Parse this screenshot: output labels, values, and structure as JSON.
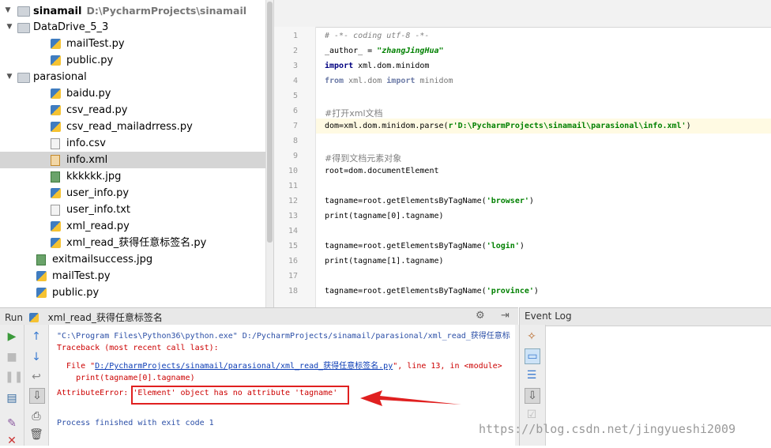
{
  "project": {
    "root": {
      "label": "sinamail",
      "path": "D:\\PycharmProjects\\sinamail"
    },
    "items": [
      {
        "label": "DataDrive_5_3",
        "kind": "folder",
        "open": true
      },
      {
        "label": "mailTest.py",
        "kind": "py"
      },
      {
        "label": "public.py",
        "kind": "py"
      },
      {
        "label": "parasional",
        "kind": "folder",
        "open": true
      },
      {
        "label": "baidu.py",
        "kind": "py"
      },
      {
        "label": "csv_read.py",
        "kind": "py"
      },
      {
        "label": "csv_read_mailadrress.py",
        "kind": "py"
      },
      {
        "label": "info.csv",
        "kind": "txt"
      },
      {
        "label": "info.xml",
        "kind": "xml",
        "selected": true
      },
      {
        "label": "kkkkkk.jpg",
        "kind": "img"
      },
      {
        "label": "user_info.py",
        "kind": "py"
      },
      {
        "label": "user_info.txt",
        "kind": "txt"
      },
      {
        "label": "xml_read.py",
        "kind": "py"
      },
      {
        "label": "xml_read_获得任意标签名.py",
        "kind": "py"
      },
      {
        "label": "exitmailsuccess.jpg",
        "kind": "img"
      },
      {
        "label": "mailTest.py",
        "kind": "py"
      },
      {
        "label": "public.py",
        "kind": "py"
      }
    ]
  },
  "editor": {
    "line_numbers": [
      "1",
      "2",
      "3",
      "4",
      "5",
      "6",
      "7",
      "8",
      "9",
      "10",
      "11",
      "12",
      "13",
      "14",
      "15",
      "16",
      "17",
      "18"
    ],
    "lines": {
      "l1": "# -*- coding utf-8 -*-",
      "l2a": "_author_ = ",
      "l2b": "\"zhangJingHua\"",
      "l3a": "import",
      "l3b": " xml.dom.minidom",
      "l4a": "from",
      "l4b": " xml.dom ",
      "l4c": "import",
      "l4d": " minidom",
      "l6": "#打开xml文档",
      "l7a": "dom=xml.dom.minidom.parse(",
      "l7b": "r'D:\\PycharmProjects\\sinamail\\parasional\\info.xml'",
      "l7c": ")",
      "l9": "#得到文档元素对象",
      "l10": "root=dom.documentElement",
      "l12a": "tagname=root.getElementsByTagName(",
      "l12b": "'browser'",
      "l12c": ")",
      "l13": "print(tagname[0].tagname)",
      "l15a": "tagname=root.getElementsByTagName(",
      "l15b": "'login'",
      "l15c": ")",
      "l16": "print(tagname[1].tagname)",
      "l18a": "tagname=root.getElementsByTagName(",
      "l18b": "'province'",
      "l18c": ")"
    }
  },
  "run": {
    "title": "Run",
    "config": "xml_read_获得任意标签名",
    "console": {
      "cmd": "\"C:\\Program Files\\Python36\\python.exe\" D:/PycharmProjects/sinamail/parasional/xml_read_获得任意标",
      "traceback": "Traceback (most recent call last):",
      "file_prefix": "  File \"",
      "file_link": "D:/PycharmProjects/sinamail/parasional/xml_read_获得任意标签名.py",
      "file_suffix": "\", line 13, in <module>",
      "code_line": "    print(tagname[0].tagname)",
      "error_prefix": "AttributeError: ",
      "error_msg": "'Element' object has no attribute 'tagname'",
      "finished": "Process finished with exit code 1"
    }
  },
  "event_log": {
    "title": "Event Log"
  },
  "watermark": "https://blog.csdn.net/jingyueshi2009",
  "colors": {
    "error_box": "#e02020",
    "error_text": "#cc0000",
    "link": "#0b3cb5"
  }
}
